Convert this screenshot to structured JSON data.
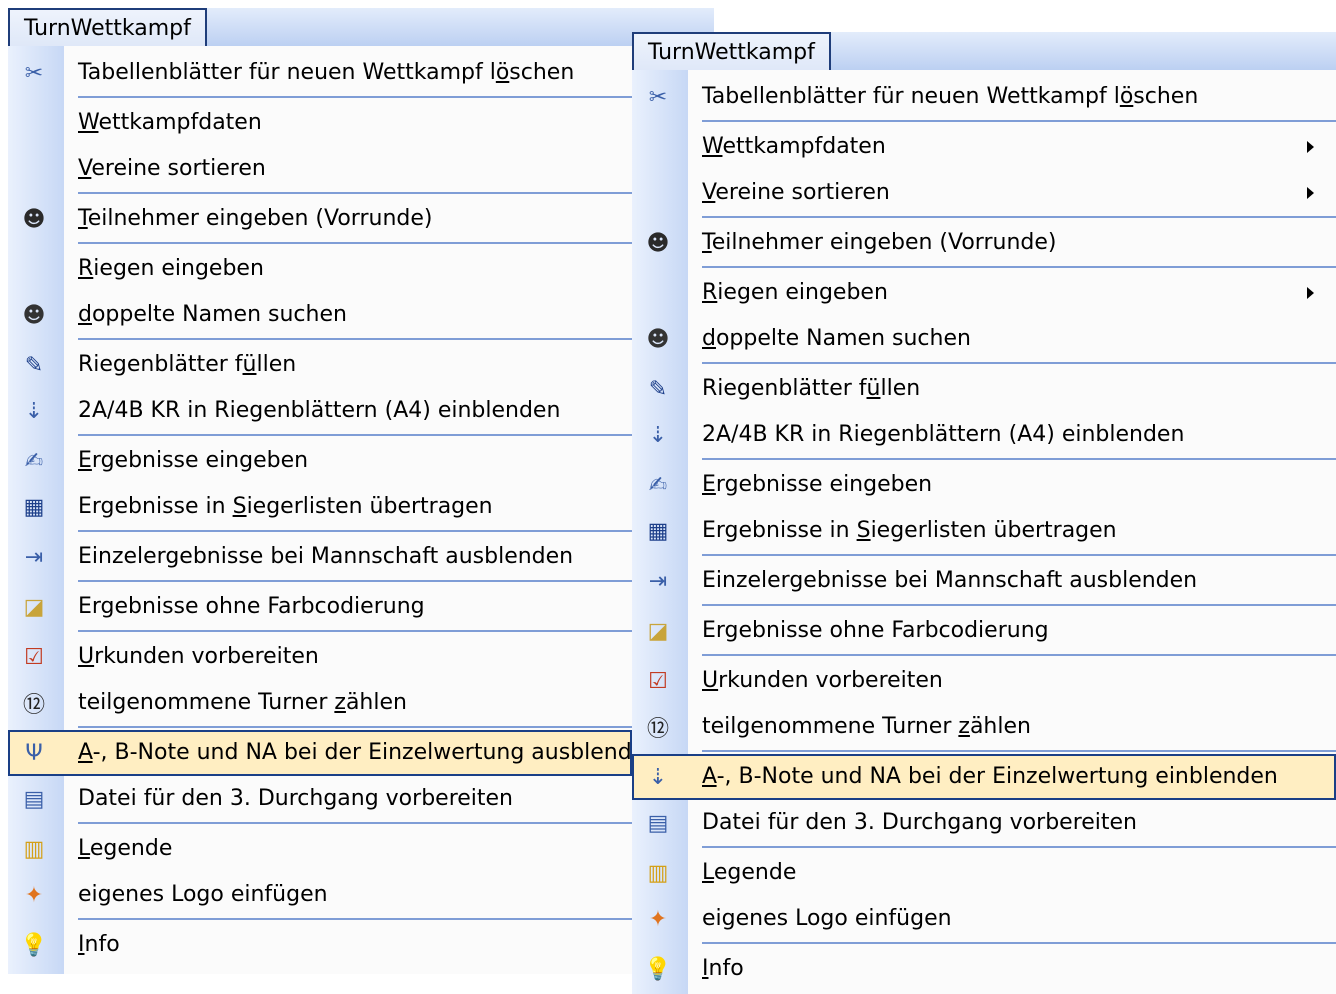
{
  "menus": [
    {
      "title": "TurnWettkampf",
      "items": [
        {
          "pre": "Tabellenblätter für neuen Wettkampf l",
          "key": "ö",
          "post": "schen",
          "icon": "delete-sheet-icon",
          "glyph": "✂",
          "color": "#3a5fa8",
          "sep_after": true
        },
        {
          "pre": "",
          "key": "W",
          "post": "ettkampfdaten",
          "icon": "",
          "glyph": "",
          "color": "",
          "submenu": false
        },
        {
          "pre": "",
          "key": "V",
          "post": "ereine sortieren",
          "icon": "",
          "glyph": "",
          "color": "",
          "sep_after": true
        },
        {
          "pre": "",
          "key": "T",
          "post": "eilnehmer eingeben    (Vorrunde)",
          "icon": "people-arrow-icon",
          "glyph": "☻",
          "color": "#2a2a2a",
          "sep_after": true
        },
        {
          "pre": "",
          "key": "R",
          "post": "iegen eingeben",
          "icon": "",
          "glyph": "",
          "color": ""
        },
        {
          "pre": "",
          "key": "d",
          "post": "oppelte Namen suchen",
          "icon": "people-search-icon",
          "glyph": "☻",
          "color": "#333333",
          "sep_after": true
        },
        {
          "pre": "Riegenblätter f",
          "key": "ü",
          "post": "llen",
          "icon": "pencil-form-icon",
          "glyph": "✎",
          "color": "#1d3f8a"
        },
        {
          "pre": "2A/4B KR in Riegenblättern (A4) einblenden",
          "key": "",
          "post": "",
          "icon": "hierarchy-icon",
          "glyph": "⇣",
          "color": "#3a5fa8",
          "sep_after": true
        },
        {
          "pre": "",
          "key": "E",
          "post": "rgebnisse eingeben",
          "icon": "edit-icon",
          "glyph": "✍",
          "color": "#3a5fa8"
        },
        {
          "pre": "Ergebnisse in ",
          "key": "S",
          "post": "iegerlisten übertragen",
          "icon": "table-transfer-icon",
          "glyph": "▦",
          "color": "#1d3f8a",
          "sep_after": true
        },
        {
          "pre": "Einzelergebnisse bei Mannschaft ausblenden",
          "key": "",
          "post": "",
          "icon": "hide-arrow-icon",
          "glyph": "⇥",
          "color": "#3a5fa8",
          "sep_after": true
        },
        {
          "pre": "Ergebnisse ohne Farbcodierung",
          "key": "",
          "post": "",
          "icon": "no-color-icon",
          "glyph": "◪",
          "color": "#c8a43a",
          "sep_after": true
        },
        {
          "pre": "",
          "key": "U",
          "post": "rkunden vorbereiten",
          "icon": "certificate-icon",
          "glyph": "☑",
          "color": "#c23b22"
        },
        {
          "pre": "teilgenommene Turner ",
          "key": "z",
          "post": "ählen",
          "icon": "calendar-12-icon",
          "glyph": "⑫",
          "color": "#222222",
          "sep_after": true
        },
        {
          "pre": "",
          "key": "A",
          "post": "-, B-Note und NA bei der Einzelwertung ausblenden",
          "icon": "filter-icon",
          "glyph": "Ψ",
          "color": "#3a5fa8",
          "selected": true
        },
        {
          "pre": "Datei für den 3. Durchgang vorbereiten",
          "key": "",
          "post": "",
          "icon": "grid-icon",
          "glyph": "▤",
          "color": "#3a5fa8",
          "sep_after": true
        },
        {
          "pre": "",
          "key": "L",
          "post": "egende",
          "icon": "books-icon",
          "glyph": "▥",
          "color": "#d4a017"
        },
        {
          "pre": "eigenes Logo einfügen",
          "key": "",
          "post": "",
          "icon": "logo-icon",
          "glyph": "✦",
          "color": "#e0741f",
          "sep_after": true
        },
        {
          "pre": "",
          "key": "I",
          "post": "nfo",
          "icon": "lightbulb-icon",
          "glyph": "💡",
          "color": "#e8c020"
        }
      ]
    },
    {
      "title": "TurnWettkampf",
      "items": [
        {
          "pre": "Tabellenblätter für neuen Wettkampf l",
          "key": "ö",
          "post": "schen",
          "icon": "delete-sheet-icon",
          "glyph": "✂",
          "color": "#3a5fa8",
          "sep_after": true
        },
        {
          "pre": "",
          "key": "W",
          "post": "ettkampfdaten",
          "icon": "",
          "glyph": "",
          "color": "",
          "submenu": true
        },
        {
          "pre": "",
          "key": "V",
          "post": "ereine sortieren",
          "icon": "",
          "glyph": "",
          "color": "",
          "submenu": true,
          "sep_after": true
        },
        {
          "pre": "",
          "key": "T",
          "post": "eilnehmer eingeben    (Vorrunde)",
          "icon": "people-arrow-icon",
          "glyph": "☻",
          "color": "#2a2a2a",
          "sep_after": true
        },
        {
          "pre": "",
          "key": "R",
          "post": "iegen eingeben",
          "icon": "",
          "glyph": "",
          "color": "",
          "submenu": true
        },
        {
          "pre": "",
          "key": "d",
          "post": "oppelte Namen suchen",
          "icon": "people-search-icon",
          "glyph": "☻",
          "color": "#333333",
          "sep_after": true
        },
        {
          "pre": "Riegenblätter f",
          "key": "ü",
          "post": "llen",
          "icon": "pencil-form-icon",
          "glyph": "✎",
          "color": "#1d3f8a"
        },
        {
          "pre": "2A/4B KR in Riegenblättern (A4) einblenden",
          "key": "",
          "post": "",
          "icon": "hierarchy-icon",
          "glyph": "⇣",
          "color": "#3a5fa8",
          "sep_after": true
        },
        {
          "pre": "",
          "key": "E",
          "post": "rgebnisse eingeben",
          "icon": "edit-icon",
          "glyph": "✍",
          "color": "#3a5fa8"
        },
        {
          "pre": "Ergebnisse in ",
          "key": "S",
          "post": "iegerlisten übertragen",
          "icon": "table-transfer-icon",
          "glyph": "▦",
          "color": "#1d3f8a",
          "sep_after": true
        },
        {
          "pre": "Einzelergebnisse bei Mannschaft ausblenden",
          "key": "",
          "post": "",
          "icon": "hide-arrow-icon",
          "glyph": "⇥",
          "color": "#3a5fa8",
          "sep_after": true
        },
        {
          "pre": "Ergebnisse ohne Farbcodierung",
          "key": "",
          "post": "",
          "icon": "no-color-icon",
          "glyph": "◪",
          "color": "#c8a43a",
          "sep_after": true
        },
        {
          "pre": "",
          "key": "U",
          "post": "rkunden vorbereiten",
          "icon": "certificate-icon",
          "glyph": "☑",
          "color": "#c23b22"
        },
        {
          "pre": "teilgenommene Turner ",
          "key": "z",
          "post": "ählen",
          "icon": "calendar-12-icon",
          "glyph": "⑫",
          "color": "#222222",
          "sep_after": true
        },
        {
          "pre": "",
          "key": "A",
          "post": "-, B-Note und NA bei der Einzelwertung einblenden",
          "icon": "hierarchy-icon",
          "glyph": "⇣",
          "color": "#3a5fa8",
          "selected": true
        },
        {
          "pre": "Datei für den 3. Durchgang vorbereiten",
          "key": "",
          "post": "",
          "icon": "grid-icon",
          "glyph": "▤",
          "color": "#3a5fa8",
          "sep_after": true
        },
        {
          "pre": "",
          "key": "L",
          "post": "egende",
          "icon": "books-icon",
          "glyph": "▥",
          "color": "#d4a017"
        },
        {
          "pre": "eigenes Logo einfügen",
          "key": "",
          "post": "",
          "icon": "logo-icon",
          "glyph": "✦",
          "color": "#e0741f",
          "sep_after": true
        },
        {
          "pre": "",
          "key": "I",
          "post": "nfo",
          "icon": "lightbulb-icon",
          "glyph": "💡",
          "color": "#e8c020"
        }
      ]
    }
  ]
}
